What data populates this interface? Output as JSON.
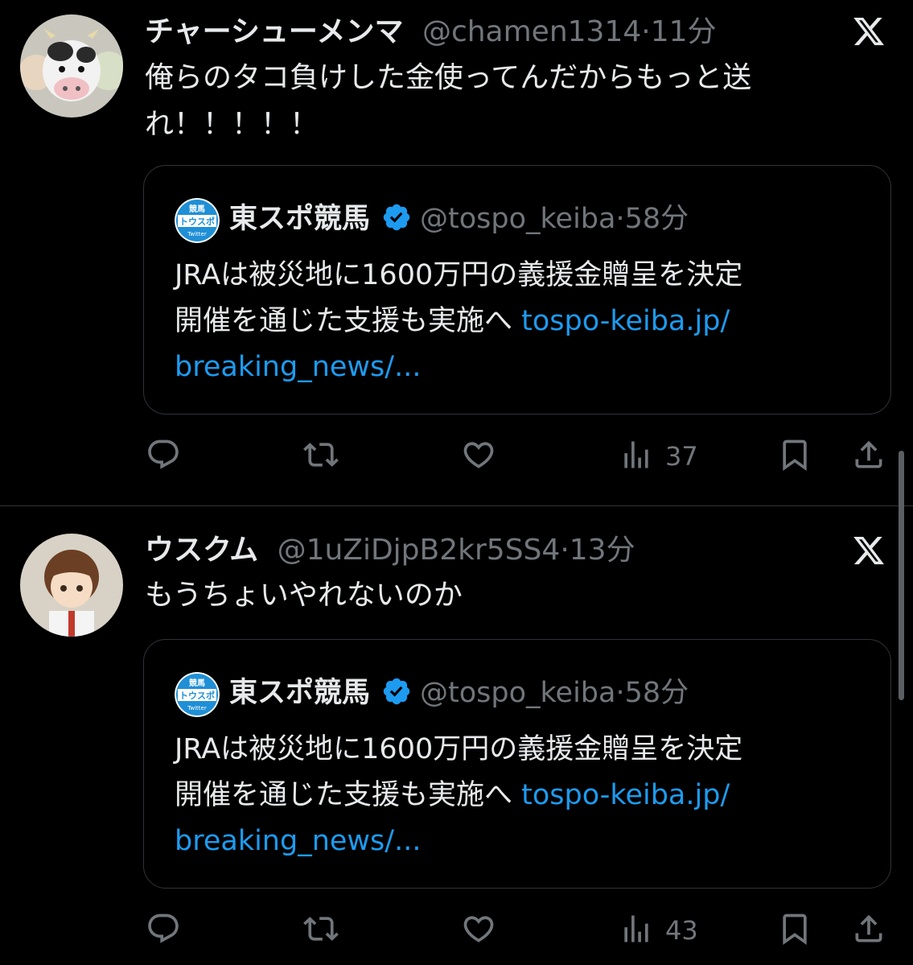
{
  "tweets": [
    {
      "name": "チャーシューメンマ",
      "handle": "@chamen1314",
      "time": "11分",
      "text_line1": "俺らのタコ負けした金使ってんだからもっと送",
      "text_line2": "れ！！！！！",
      "quote": {
        "name": "東スポ競馬",
        "handle": "@tospo_keiba",
        "time": "58分",
        "text_line1": "JRAは被災地に1600万円の義援金贈呈を決定",
        "text_line2": "開催を通じた支援も実施へ",
        "link_part1": "tospo-keiba.jp/",
        "link_part2": "breaking_news/..."
      },
      "views": "37"
    },
    {
      "name": "ウスクム",
      "handle": "@1uZiDjpB2kr5SS4",
      "time": "13分",
      "text_line1": "もうちょいやれないのか",
      "quote": {
        "name": "東スポ競馬",
        "handle": "@tospo_keiba",
        "time": "58分",
        "text_line1": "JRAは被災地に1600万円の義援金贈呈を決定",
        "text_line2": "開催を通じた支援も実施へ",
        "link_part1": "tospo-keiba.jp/",
        "link_part2": "breaking_news/..."
      },
      "views": "43"
    }
  ],
  "tospo_logo": {
    "top": "競馬",
    "middle": "トウスポ",
    "bottom": "Twitter"
  },
  "icons": {
    "reply": "reply-icon",
    "retweet": "retweet-icon",
    "like": "heart-icon",
    "views": "views-icon",
    "bookmark": "bookmark-icon",
    "share": "share-icon",
    "brand": "x-logo-icon",
    "verified": "verified-badge-icon"
  },
  "colors": {
    "background": "#000000",
    "text": "#e7e9ea",
    "secondary": "#71767b",
    "link": "#1d9bf0",
    "border": "#2f3336"
  }
}
